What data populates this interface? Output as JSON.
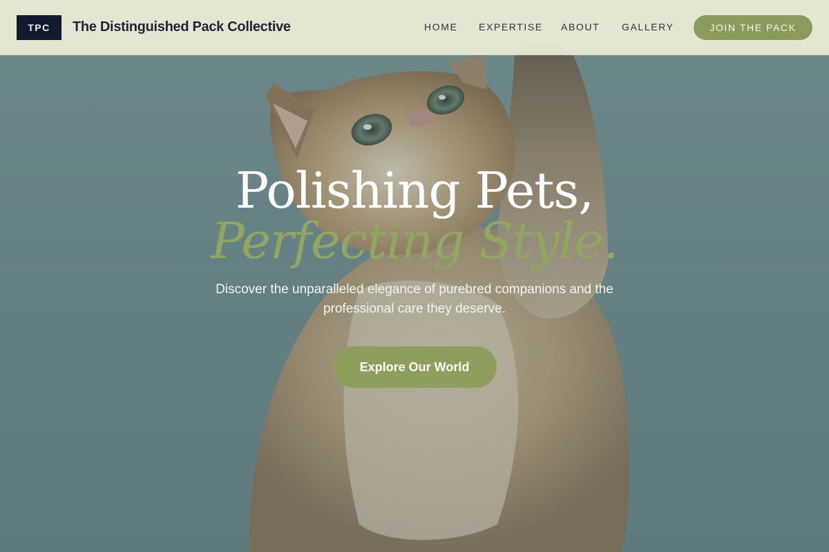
{
  "header": {
    "logo_text": "TPC",
    "brand_name": "The Distinguished Pack Collective",
    "nav": [
      {
        "label": "HOME"
      },
      {
        "label": "EXPERTISE"
      },
      {
        "label": "ABOUT"
      },
      {
        "label": "GALLERY"
      }
    ],
    "cta_label": "JOIN THE PACK"
  },
  "hero": {
    "headline_line1": "Polishing Pets,",
    "headline_line2": "Perfecting Style.",
    "subtitle": "Discover the unparalleled elegance of purebred companions and the professional care they deserve.",
    "cta_label": "Explore Our World",
    "image_subject": "kitten-reaching-up-photo"
  },
  "colors": {
    "header_bg": "#eceed6",
    "logo_bg": "#121a30",
    "accent_olive": "#8d9f5e",
    "headline_italic": "#91a660",
    "hero_bg": "#738f91"
  }
}
